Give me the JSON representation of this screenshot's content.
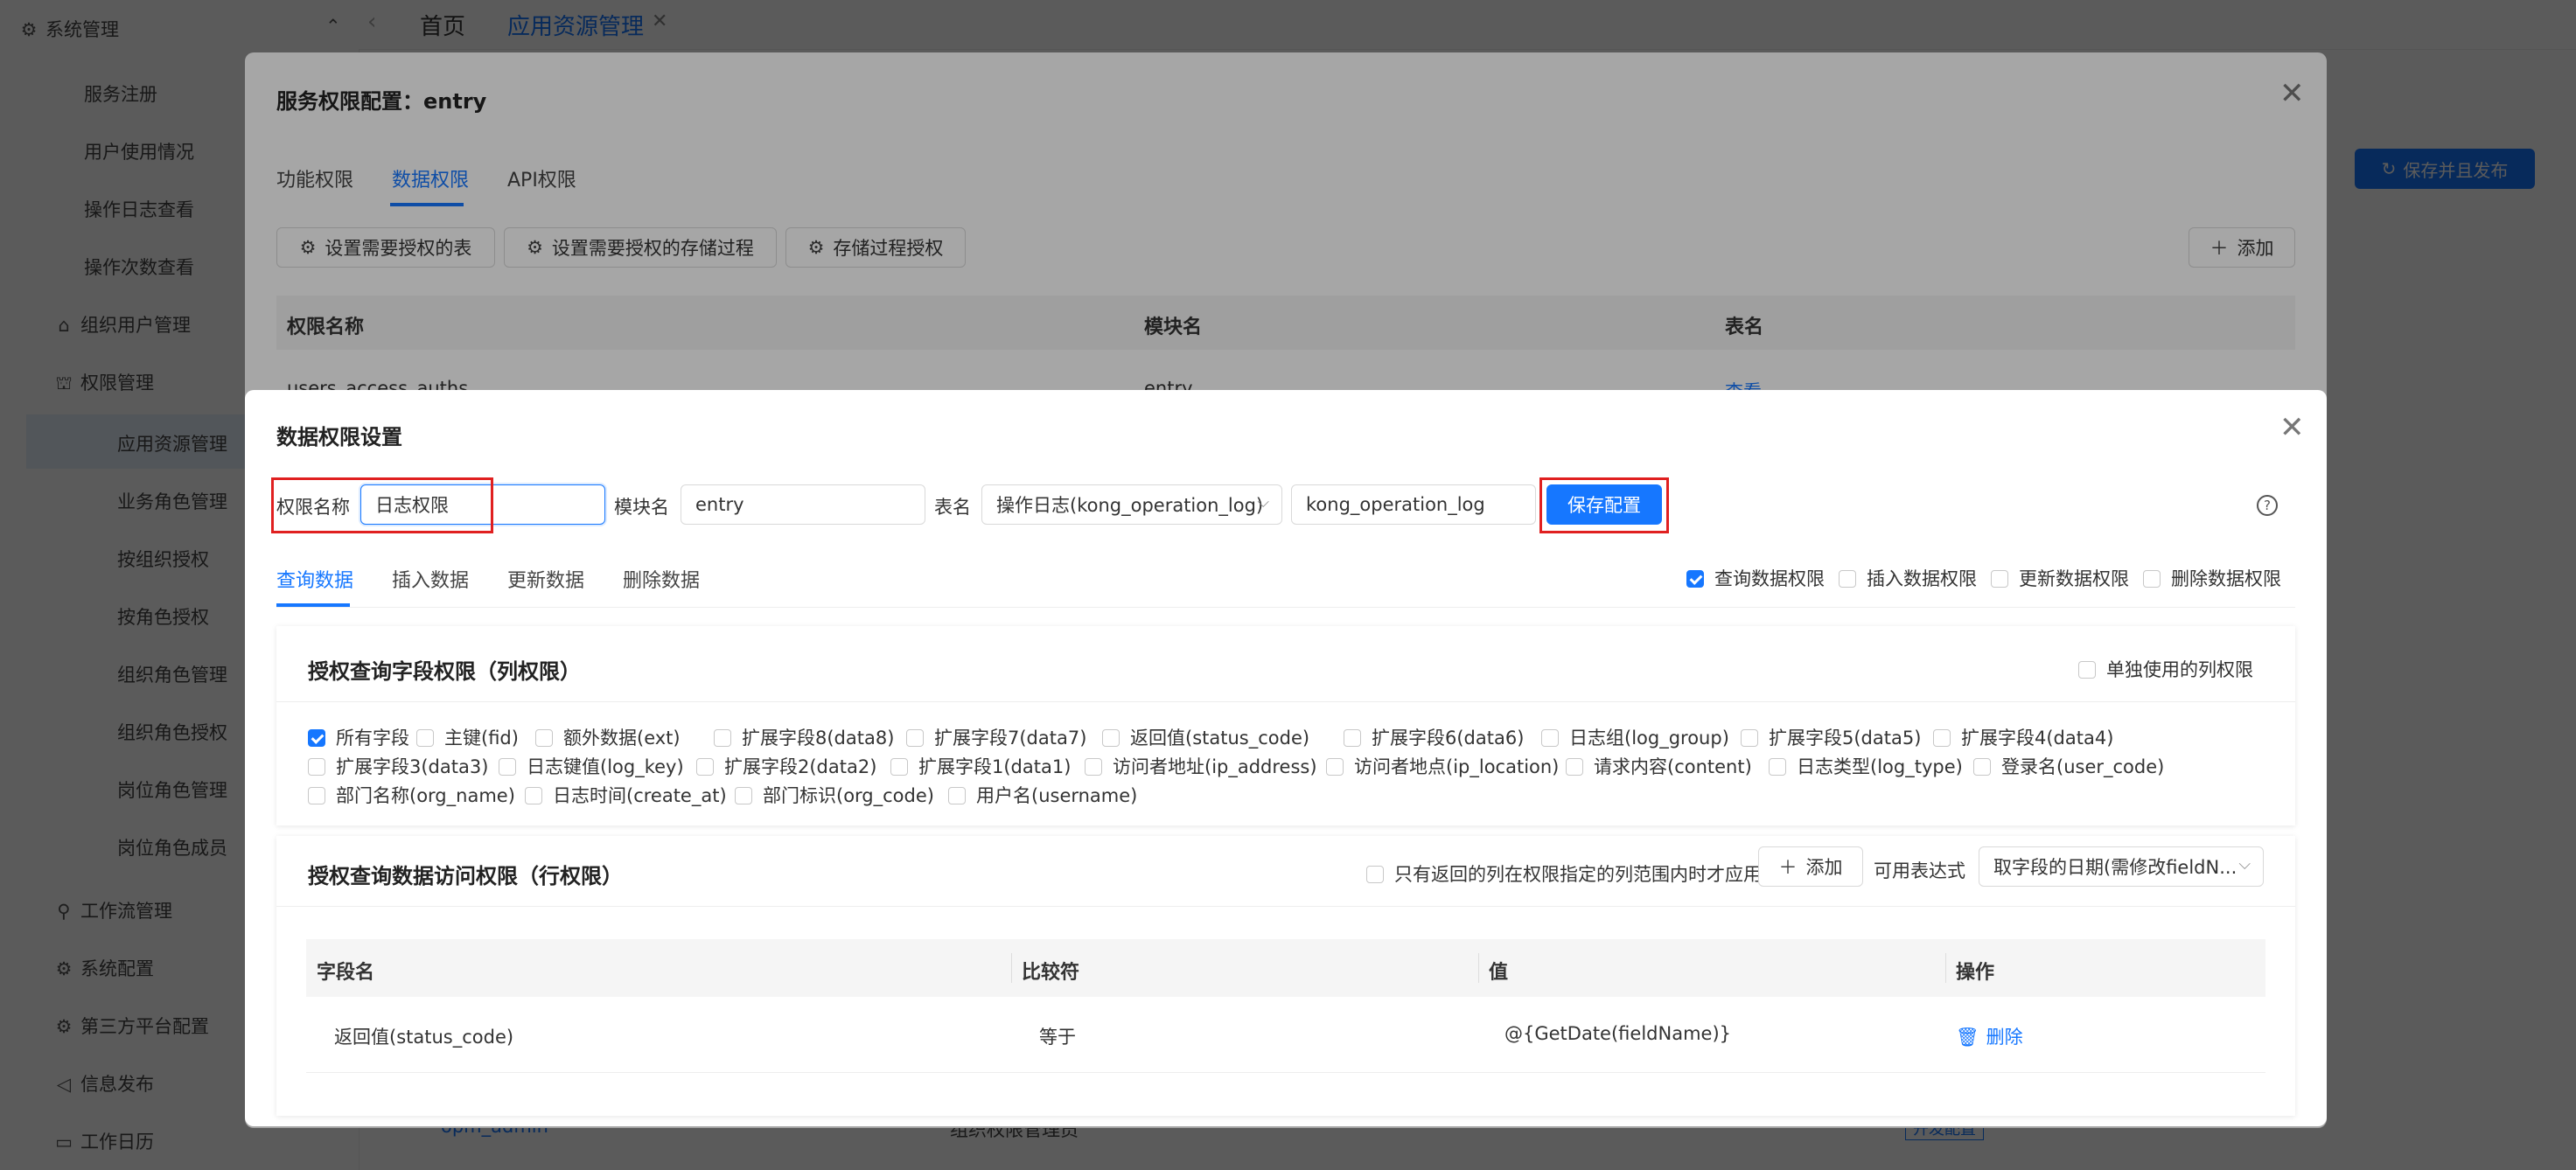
{
  "sidebar": {
    "group_system": "系统管理",
    "items": [
      {
        "label": "服务注册"
      },
      {
        "label": "用户使用情况"
      },
      {
        "label": "操作日志查看"
      },
      {
        "label": "操作次数查看"
      }
    ],
    "org_user": "组织用户管理",
    "perm_mgmt": "权限管理",
    "perm_items": [
      {
        "label": "应用资源管理"
      },
      {
        "label": "业务角色管理"
      },
      {
        "label": "按组织授权"
      },
      {
        "label": "按角色授权"
      },
      {
        "label": "组织角色管理"
      },
      {
        "label": "组织角色授权"
      },
      {
        "label": "岗位角色管理"
      },
      {
        "label": "岗位角色成员"
      }
    ],
    "workflow": "工作流管理",
    "sys_config": "系统配置",
    "third_party": "第三方平台配置",
    "info_publish": "信息发布",
    "work_calendar": "工作日历"
  },
  "topbar": {
    "home_tab": "首页",
    "active_tab": "应用资源管理",
    "save_publish": "保存并且发布"
  },
  "background": {
    "row_name": "opm_admin",
    "row_module": "组织权限管理员",
    "row_badge": "开发配置"
  },
  "outer_modal": {
    "title": "服务权限配置：entry",
    "tabs": [
      "功能权限",
      "数据权限",
      "API权限"
    ],
    "active_tab": "数据权限",
    "btn_set_tables": "设置需要授权的表",
    "btn_set_procs": "设置需要授权的存储过程",
    "btn_proc_auth": "存储过程授权",
    "btn_add": "添加",
    "columns": [
      "权限名称",
      "模块名",
      "表名"
    ],
    "row_partial": [
      "users_access_auths",
      "entry",
      "查看"
    ]
  },
  "inner_modal": {
    "title": "数据权限设置",
    "perm_name_label": "权限名称",
    "perm_name_value": "日志权限",
    "module_label": "模块名",
    "module_value": "entry",
    "table_label": "表名",
    "table_select": "操作日志(kong_operation_log)",
    "table_input": "kong_operation_log",
    "save_button": "保存配置",
    "tabs": [
      "查询数据",
      "插入数据",
      "更新数据",
      "删除数据"
    ],
    "active_tab": "查询数据",
    "right_checks": [
      {
        "label": "查询数据权限",
        "checked": true
      },
      {
        "label": "插入数据权限",
        "checked": false
      },
      {
        "label": "更新数据权限",
        "checked": false
      },
      {
        "label": "删除数据权限",
        "checked": false
      }
    ],
    "column_section": {
      "title": "授权查询字段权限（列权限）",
      "standalone_label": "单独使用的列权限",
      "row1": [
        {
          "label": "所有字段",
          "checked": true
        },
        {
          "label": "主键(fid)",
          "checked": false
        },
        {
          "label": "额外数据(ext)",
          "checked": false
        },
        {
          "label": "扩展字段8(data8)",
          "checked": false
        },
        {
          "label": "扩展字段7(data7)",
          "checked": false
        },
        {
          "label": "返回值(status_code)",
          "checked": false
        },
        {
          "label": "扩展字段6(data6)",
          "checked": false
        },
        {
          "label": "日志组(log_group)",
          "checked": false
        },
        {
          "label": "扩展字段5(data5)",
          "checked": false
        },
        {
          "label": "扩展字段4(data4)",
          "checked": false
        }
      ],
      "row2": [
        {
          "label": "扩展字段3(data3)",
          "checked": false
        },
        {
          "label": "日志键值(log_key)",
          "checked": false
        },
        {
          "label": "扩展字段2(data2)",
          "checked": false
        },
        {
          "label": "扩展字段1(data1)",
          "checked": false
        },
        {
          "label": "访问者地址(ip_address)",
          "checked": false
        },
        {
          "label": "访问者地点(ip_location)",
          "checked": false
        },
        {
          "label": "请求内容(content)",
          "checked": false
        },
        {
          "label": "日志类型(log_type)",
          "checked": false
        },
        {
          "label": "登录名(user_code)",
          "checked": false
        }
      ],
      "row3": [
        {
          "label": "部门名称(org_name)",
          "checked": false
        },
        {
          "label": "日志时间(create_at)",
          "checked": false
        },
        {
          "label": "部门标识(org_code)",
          "checked": false
        },
        {
          "label": "用户名(username)",
          "checked": false
        }
      ]
    },
    "row_section": {
      "title": "授权查询数据访问权限（行权限）",
      "only_returned_label": "只有返回的列在权限指定的列范围内时才应用",
      "add_button": "添加",
      "expr_label": "可用表达式",
      "expr_select": "取字段的日期(需修改fieldN...",
      "columns": [
        "字段名",
        "比较符",
        "值",
        "操作"
      ],
      "rows": [
        {
          "field": "返回值(status_code)",
          "op": "等于",
          "value": "@{GetDate(fieldName)}",
          "action": "删除"
        }
      ]
    }
  }
}
